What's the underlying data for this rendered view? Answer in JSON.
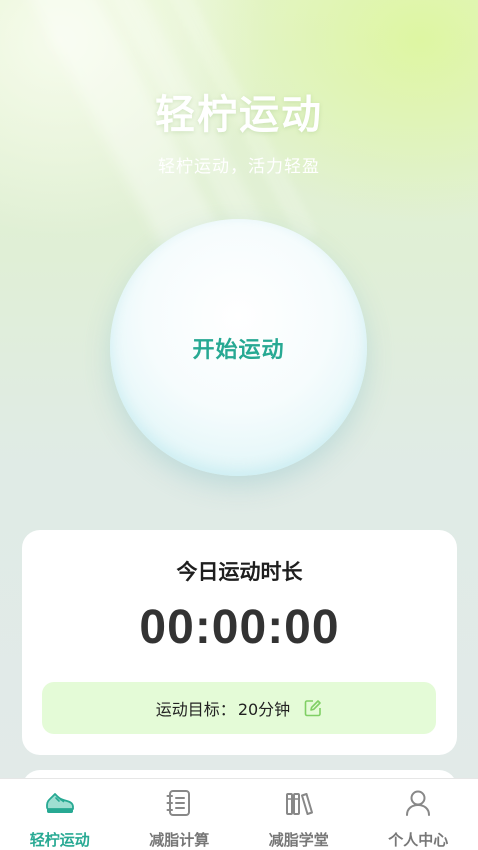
{
  "header": {
    "title": "轻柠运动",
    "subtitle": "轻柠运动，活力轻盈"
  },
  "start_button": {
    "label": "开始运动"
  },
  "today_card": {
    "title": "今日运动时长",
    "timer": "00:00:00",
    "goal_label": "运动目标：",
    "goal_value": "20分钟"
  },
  "tabbar": {
    "items": [
      {
        "label": "轻柠运动",
        "icon": "sneaker-icon",
        "active": true
      },
      {
        "label": "减脂计算",
        "icon": "notebook-icon",
        "active": false
      },
      {
        "label": "减脂学堂",
        "icon": "books-icon",
        "active": false
      },
      {
        "label": "个人中心",
        "icon": "person-icon",
        "active": false
      }
    ]
  },
  "colors": {
    "accent": "#27a993",
    "goal_bg": "#e4fbd7",
    "inactive": "#777777"
  }
}
